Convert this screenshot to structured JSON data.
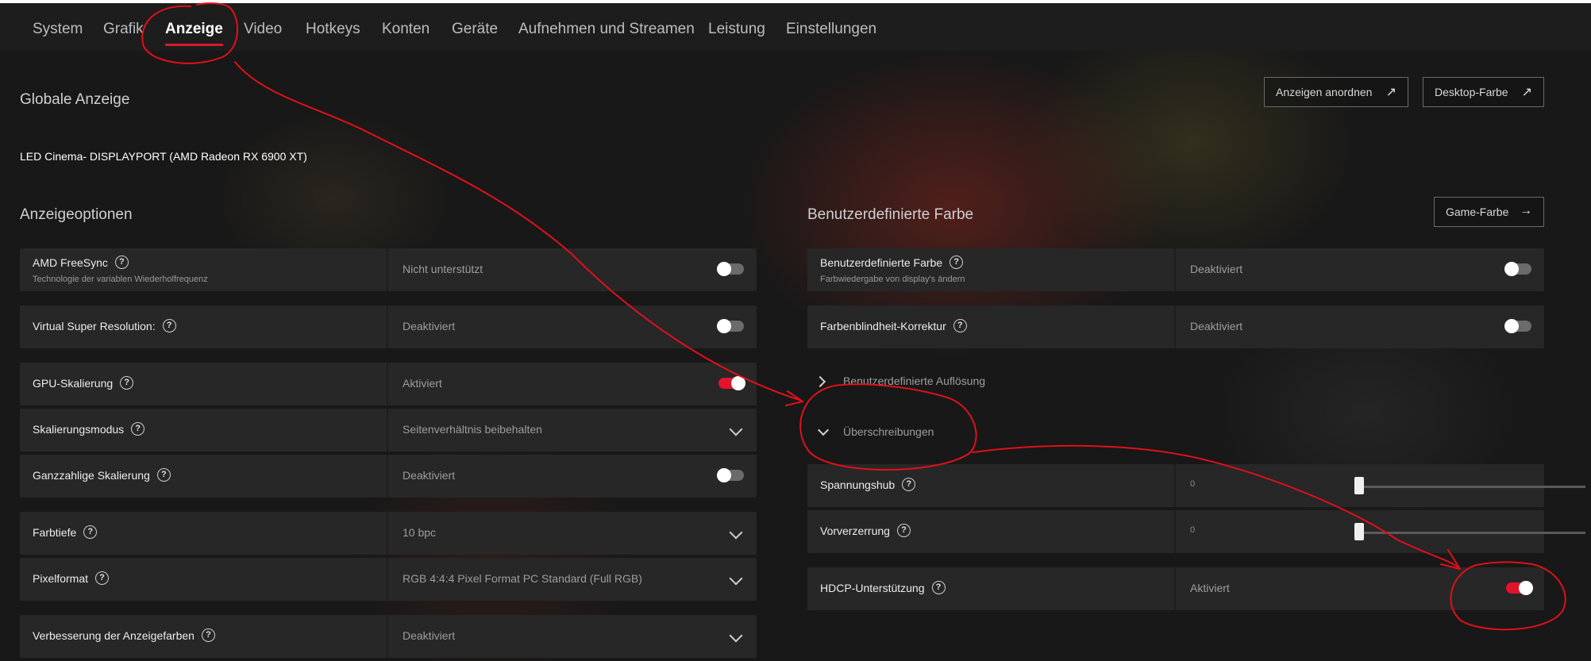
{
  "tabs": [
    "System",
    "Grafik",
    "Anzeige",
    "Video",
    "Hotkeys",
    "Konten",
    "Geräte",
    "Aufnehmen und Streamen",
    "Leistung",
    "Einstellungen"
  ],
  "active_tab": "Anzeige",
  "global": {
    "heading": "Globale Anzeige",
    "display_name": "LED Cinema- DISPLAYPORT (AMD Radeon RX 6900 XT)",
    "btn_arrange": "Anzeigen anordnen",
    "btn_desktop_color": "Desktop-Farbe"
  },
  "options": {
    "heading": "Anzeigeoptionen",
    "freesync_label": "AMD FreeSync",
    "freesync_sub": "Technologie der variablen Wiederholfrequenz",
    "freesync_value": "Nicht unterstützt",
    "vsr_label": "Virtual Super Resolution:",
    "vsr_value": "Deaktiviert",
    "gpu_scaling_label": "GPU-Skalierung",
    "gpu_scaling_value": "Aktiviert",
    "scaling_mode_label": "Skalierungsmodus",
    "scaling_mode_value": "Seitenverhältnis beibehalten",
    "integer_scaling_label": "Ganzzahlige Skalierung",
    "integer_scaling_value": "Deaktiviert",
    "color_depth_label": "Farbtiefe",
    "color_depth_value": "10 bpc",
    "pixel_format_label": "Pixelformat",
    "pixel_format_value": "RGB 4:4:4 Pixel Format PC Standard (Full RGB)",
    "color_enh_label": "Verbesserung der Anzeigefarben",
    "color_enh_value": "Deaktiviert"
  },
  "custom": {
    "heading": "Benutzerdefinierte Farbe",
    "btn_game_color": "Game-Farbe",
    "custom_color_label": "Benutzerdefinierte Farbe",
    "custom_color_sub": "Farbwiedergabe von display's ändern",
    "custom_color_value": "Deaktiviert",
    "colorblind_label": "Farbenblindheit-Korrektur",
    "colorblind_value": "Deaktiviert",
    "custom_resolution_label": "Benutzerdefinierte Auflösung",
    "overrides_label": "Überschreibungen",
    "voltage_swing_label": "Spannungshub",
    "voltage_swing_value": "0",
    "preemphasis_label": "Vorverzerrung",
    "preemphasis_value": "0",
    "hdcp_label": "HDCP-Unterstützung",
    "hdcp_value": "Aktiviert"
  },
  "help_glyph": "?",
  "toggles": {
    "freesync": false,
    "vsr": false,
    "gpu_scaling": true,
    "integer_scaling": false,
    "custom_color": false,
    "colorblind": false,
    "hdcp": true
  },
  "sliders": {
    "voltage_swing": 0,
    "preemphasis": 0
  },
  "colors": {
    "accent": "#e3132b",
    "annotation": "#e0101a",
    "panel": "#282828"
  }
}
